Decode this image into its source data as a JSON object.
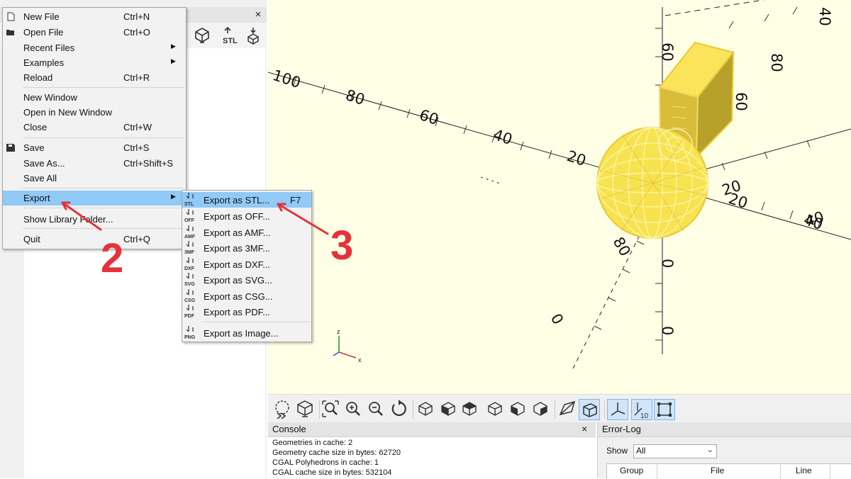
{
  "editor": {
    "close_label": "×"
  },
  "file_menu": {
    "items": [
      {
        "label": "New File",
        "shortcut": "Ctrl+N"
      },
      {
        "label": "Open File",
        "shortcut": "Ctrl+O"
      },
      {
        "label": "Recent Files",
        "shortcut": ""
      },
      {
        "label": "Examples",
        "shortcut": ""
      },
      {
        "label": "Reload",
        "shortcut": "Ctrl+R"
      },
      {
        "label": "New Window",
        "shortcut": ""
      },
      {
        "label": "Open in New Window",
        "shortcut": ""
      },
      {
        "label": "Close",
        "shortcut": "Ctrl+W"
      },
      {
        "label": "Save",
        "shortcut": "Ctrl+S"
      },
      {
        "label": "Save As...",
        "shortcut": "Ctrl+Shift+S"
      },
      {
        "label": "Save All",
        "shortcut": ""
      },
      {
        "label": "Export",
        "shortcut": ""
      },
      {
        "label": "Show Library Folder...",
        "shortcut": ""
      },
      {
        "label": "Quit",
        "shortcut": "Ctrl+Q"
      }
    ]
  },
  "export_menu": {
    "items": [
      {
        "label": "Export as STL...",
        "shortcut": "F7",
        "icon_text": "STL"
      },
      {
        "label": "Export as OFF...",
        "shortcut": "",
        "icon_text": "OFF"
      },
      {
        "label": "Export as AMF...",
        "shortcut": "",
        "icon_text": "AMF"
      },
      {
        "label": "Export as 3MF...",
        "shortcut": "",
        "icon_text": "3MF"
      },
      {
        "label": "Export as DXF...",
        "shortcut": "",
        "icon_text": "DXF"
      },
      {
        "label": "Export as SVG...",
        "shortcut": "",
        "icon_text": "SVG"
      },
      {
        "label": "Export as CSG...",
        "shortcut": "",
        "icon_text": "CSG"
      },
      {
        "label": "Export as PDF...",
        "shortcut": "",
        "icon_text": "PDF"
      },
      {
        "label": "Export as Image...",
        "shortcut": "",
        "icon_text": "PNG"
      }
    ]
  },
  "annotations": {
    "step_two": "2",
    "step_three": "3"
  },
  "viewport": {
    "axis_labels": [
      "100",
      "80",
      "60",
      "40",
      "20",
      "20",
      "40",
      "20",
      "40",
      "60",
      "80",
      "40",
      "60",
      "80",
      "0",
      "0",
      "0"
    ],
    "gizmo": {
      "z": "z",
      "x": "x"
    },
    "bg_color": "#ffffe6",
    "model_color": "#f9e04c"
  },
  "view_toolbar": {
    "scale_marker": "10"
  },
  "console": {
    "title": "Console",
    "close_label": "×",
    "lines": [
      "Geometries in cache: 2",
      "Geometry cache size in bytes: 62720",
      "CGAL Polyhedrons in cache: 1",
      "CGAL cache size in bytes: 532104"
    ]
  },
  "error_log": {
    "title": "Error-Log",
    "show_label": "Show",
    "show_value": "All",
    "columns": [
      "Group",
      "File",
      "Line"
    ]
  },
  "colors": {
    "menu_highlight": "#91c9f7",
    "annotation_red": "#e53238"
  }
}
